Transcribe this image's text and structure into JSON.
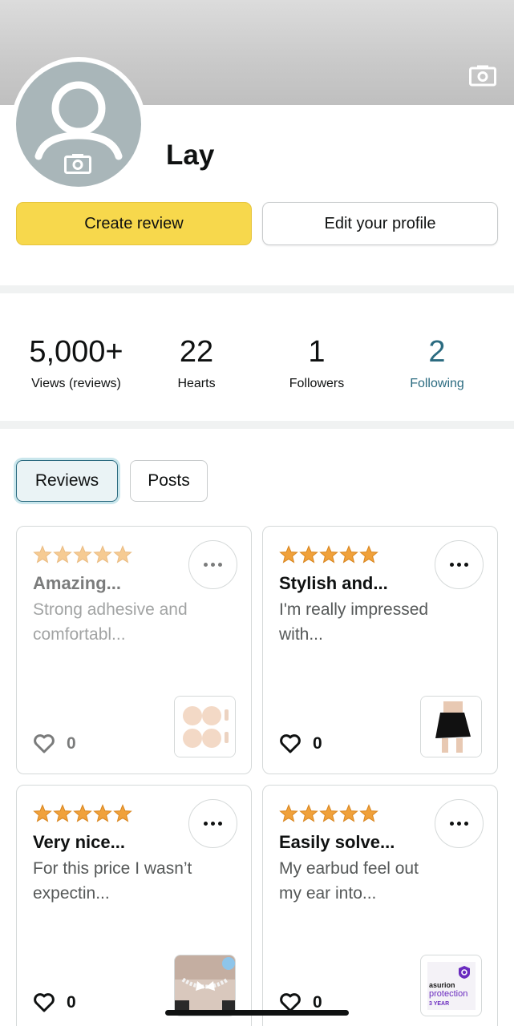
{
  "profile": {
    "name": "Lay",
    "banner_icon": "camera-icon",
    "avatar_icon": "camera-icon"
  },
  "actions": {
    "create_review": "Create review",
    "edit_profile": "Edit your profile"
  },
  "stats": [
    {
      "value": "5,000+",
      "label": "Views (reviews)"
    },
    {
      "value": "22",
      "label": "Hearts"
    },
    {
      "value": "1",
      "label": "Followers"
    },
    {
      "value": "2",
      "label": "Following"
    }
  ],
  "tabs": [
    {
      "label": "Reviews",
      "selected": true
    },
    {
      "label": "Posts",
      "selected": false
    }
  ],
  "reviews": [
    {
      "rating": 5,
      "title": "Amazing...",
      "excerpt": "Strong adhesive and comfortabl...",
      "hearts": "0",
      "thumbnail": "nipple-covers-product"
    },
    {
      "rating": 5,
      "title": "Stylish and...",
      "excerpt": "I'm really impressed with...",
      "hearts": "0",
      "thumbnail": "black-skort-product"
    },
    {
      "rating": 5,
      "title": "Very nice...",
      "excerpt": "For this price I wasn’t expectin...",
      "hearts": "0",
      "thumbnail": "butterfly-choker-product"
    },
    {
      "rating": 5,
      "title": "Easily solve...",
      "excerpt": "My earbud feel out my ear into...",
      "hearts": "0",
      "thumbnail": "asurion-protection-product"
    }
  ],
  "asurion": {
    "brand": "asurion",
    "line2": "protection",
    "line3": "3 YEAR"
  },
  "colors": {
    "primary_button": "#f7d84c",
    "link": "#2b6b80",
    "star": "#f0a13b"
  }
}
